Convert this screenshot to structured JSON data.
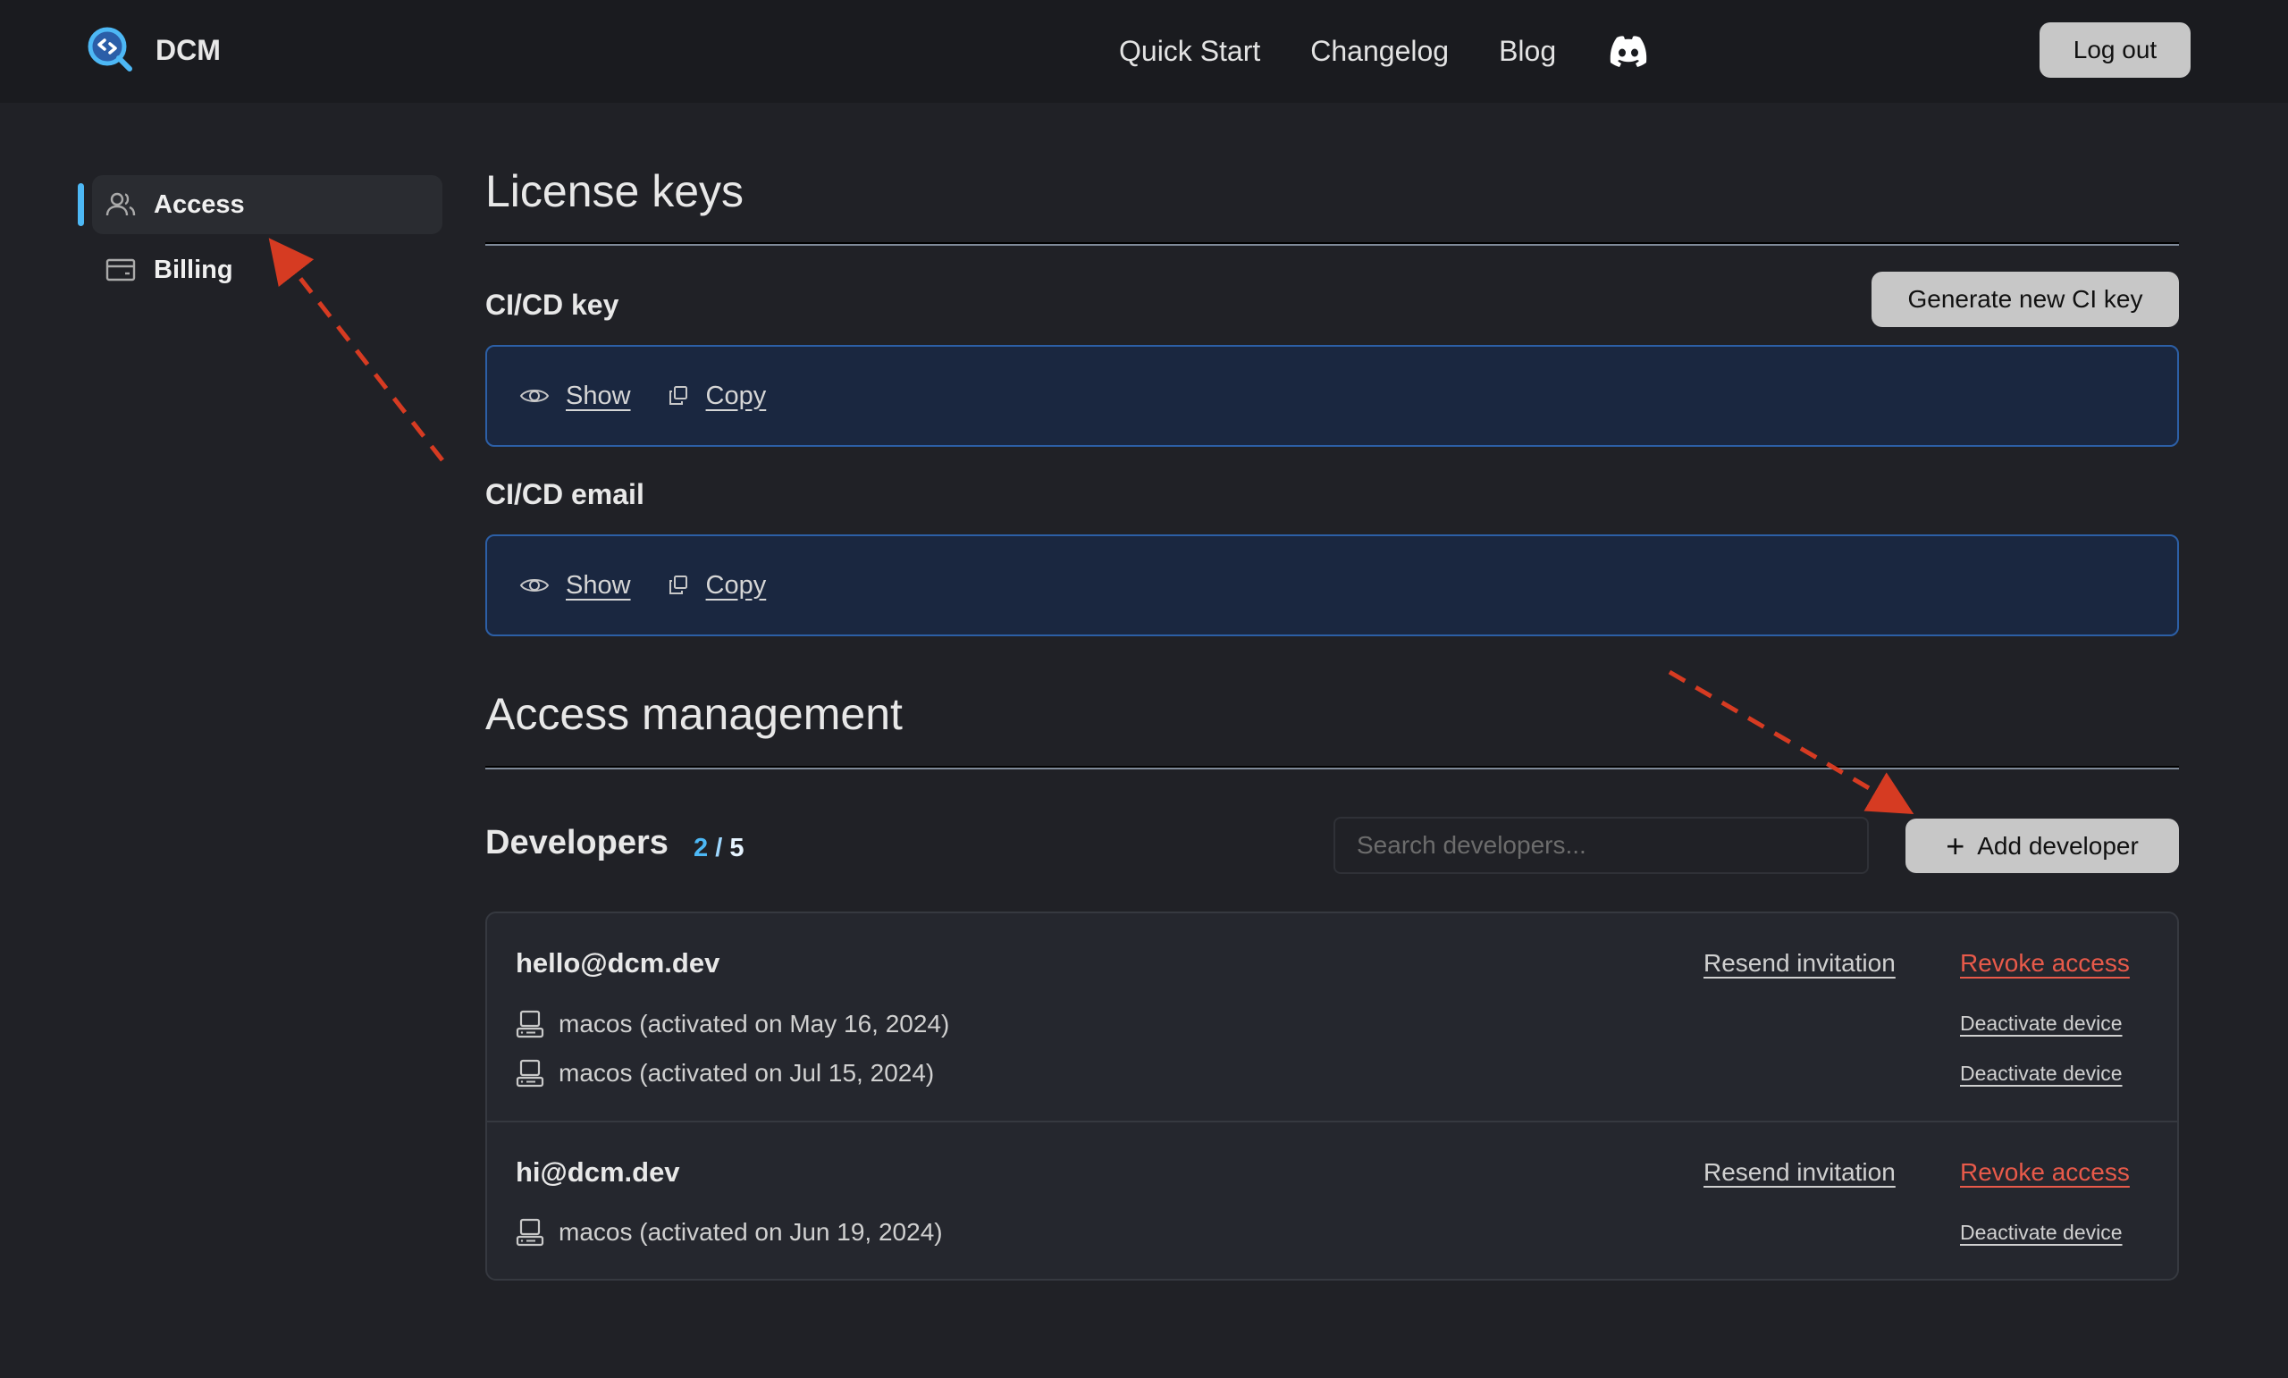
{
  "header": {
    "brand": "DCM",
    "nav": [
      "Quick Start",
      "Changelog",
      "Blog"
    ],
    "discord_icon": "discord-icon",
    "logout_label": "Log out"
  },
  "sidebar": {
    "items": [
      {
        "label": "Access",
        "icon": "users-icon",
        "active": true
      },
      {
        "label": "Billing",
        "icon": "credit-card-icon",
        "active": false
      }
    ]
  },
  "license": {
    "title": "License keys",
    "ci_key": {
      "label": "CI/CD key",
      "show": "Show",
      "copy": "Copy"
    },
    "generate_label": "Generate new CI key",
    "ci_email": {
      "label": "CI/CD email",
      "show": "Show",
      "copy": "Copy"
    }
  },
  "access": {
    "title": "Access management",
    "developers_label": "Developers",
    "count_current": "2",
    "count_sep": "/",
    "count_total": "5",
    "search_placeholder": "Search developers...",
    "add_label": "Add developer",
    "resend_label": "Resend invitation",
    "revoke_label": "Revoke access",
    "deactivate_label": "Deactivate device",
    "developers": [
      {
        "email": "hello@dcm.dev",
        "devices": [
          "macos (activated on May 16, 2024)",
          "macos (activated on Jul 15, 2024)"
        ]
      },
      {
        "email": "hi@dcm.dev",
        "devices": [
          "macos (activated on Jun 19, 2024)"
        ]
      }
    ]
  },
  "colors": {
    "accent": "#4db8f5",
    "danger": "#e85a4a",
    "annotation": "#d63b22"
  }
}
